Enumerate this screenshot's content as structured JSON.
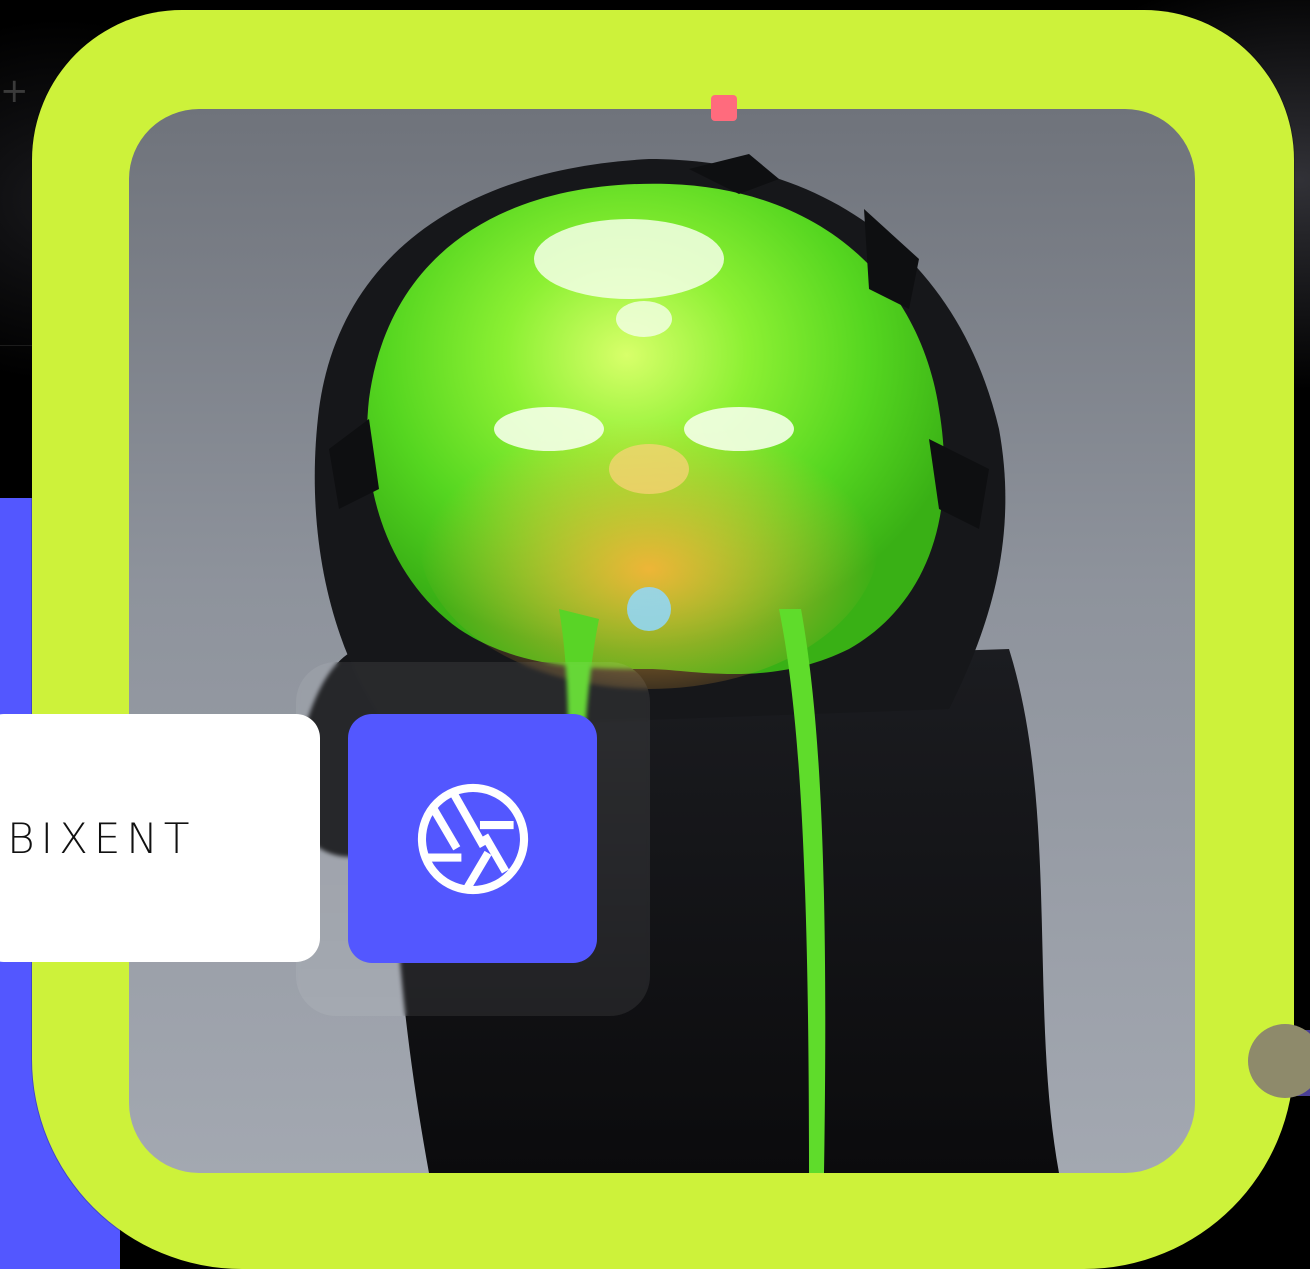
{
  "brand": {
    "logo_text": "RBIXENT"
  },
  "colors": {
    "frame": "#cdf23a",
    "accent_blue": "#5357ff",
    "pink_indicator": "#ff6b7d",
    "background": "#000000"
  },
  "icons": {
    "capture": "camera-aperture-icon",
    "decoration": "plus-icon"
  }
}
